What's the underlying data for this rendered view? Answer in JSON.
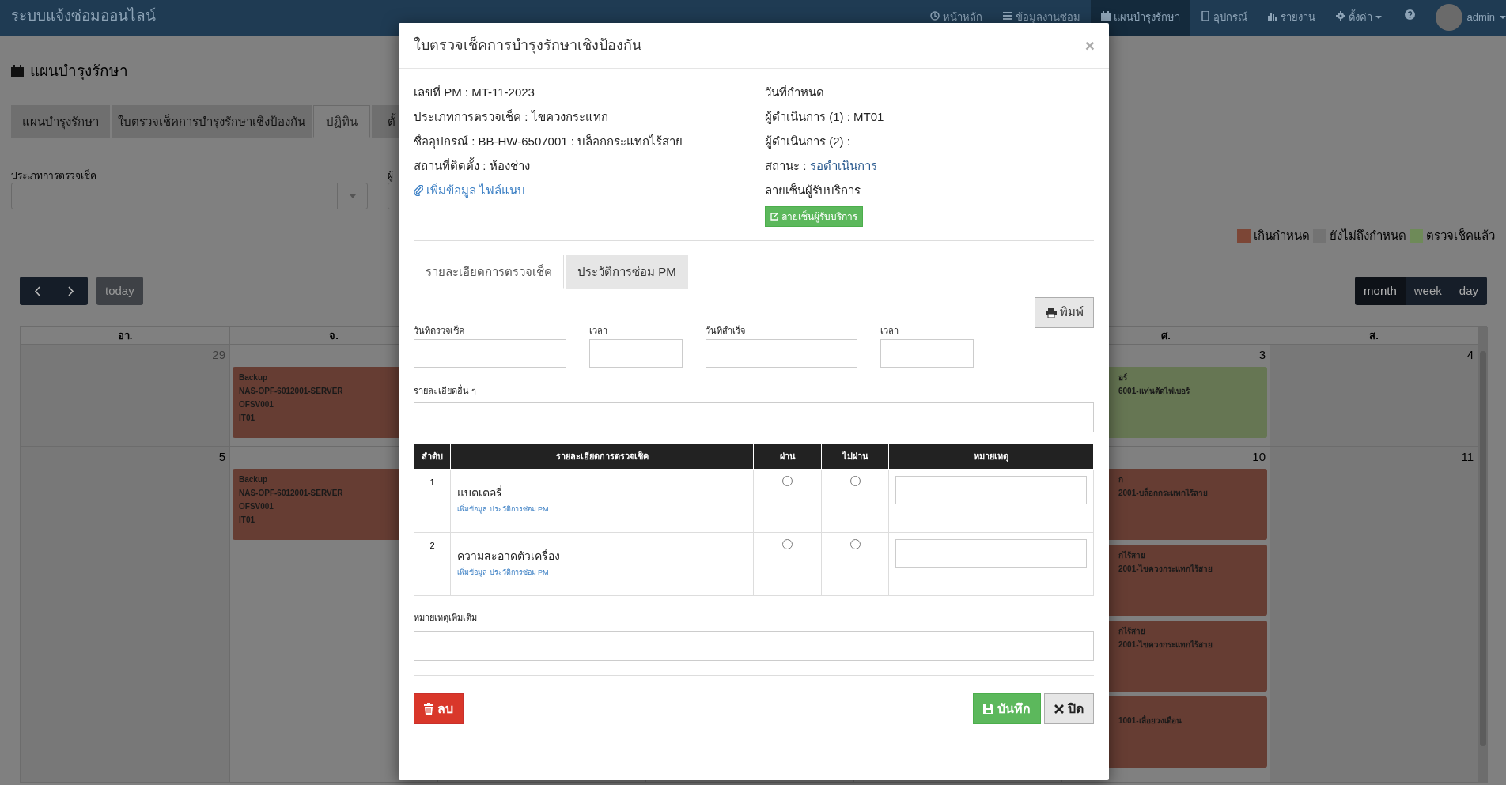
{
  "navbar": {
    "brand": "ระบบแจ้งซ่อมออนไลน์",
    "items": [
      {
        "label": "หน้าหลัก",
        "selected": false,
        "dropdown": false
      },
      {
        "label": "ข้อมูลงานซ่อม",
        "selected": false,
        "dropdown": false
      },
      {
        "label": "แผนบำรุงรักษา",
        "selected": true,
        "dropdown": false
      },
      {
        "label": "อุปกรณ์",
        "selected": false,
        "dropdown": false
      },
      {
        "label": "รายงาน",
        "selected": false,
        "dropdown": false
      },
      {
        "label": "ตั้งค่า",
        "selected": false,
        "dropdown": true
      }
    ],
    "user": "admin"
  },
  "page": {
    "title": "แผนบำรุงรักษา",
    "tabs": [
      {
        "label": "แผนบำรุงรักษา",
        "selected": false
      },
      {
        "label": "ใบตรวจเช็คการบำรุงรักษาเชิงป้องกัน",
        "selected": false
      },
      {
        "label": "ปฏิทิน",
        "selected": true
      },
      {
        "label": "ตั้",
        "selected": false
      }
    ],
    "filters": [
      {
        "label": "ประเภทการตรวจเช็ค",
        "kind": "select"
      },
      {
        "label": "ผู้",
        "kind": "input"
      }
    ]
  },
  "legend": [
    {
      "label": "เกินกำหนด",
      "color": "#7c4636"
    },
    {
      "label": "ยังไม่ถึงกำหนด",
      "color": "#737373"
    },
    {
      "label": "ตรวจเช็คแล้ว",
      "color": "#6e8a58"
    }
  ],
  "calendar": {
    "today": "today",
    "views": [
      {
        "label": "month",
        "selected": true
      },
      {
        "label": "week",
        "selected": false
      },
      {
        "label": "day",
        "selected": false
      }
    ],
    "left_days": [
      "อา.",
      "จ."
    ],
    "right_days": [
      "ศ.",
      "ส."
    ],
    "weeks": [
      {
        "days": [
          {
            "date": "29",
            "other_month": true
          },
          {
            "events": [
              {
                "lines": [
                  "Backup",
                  "NAS-OPF-6012001-SERVER",
                  "OFSV001",
                  "IT01"
                ],
                "color": "#663d33"
              }
            ]
          },
          {
            "date": "3",
            "other_month": false,
            "events": [
              {
                "lines": [
                  "อร์",
                  "6001-แท่นตัดไฟเบอร์"
                ],
                "color": "#667653"
              }
            ]
          },
          {
            "date": "4",
            "other_month": false
          }
        ]
      },
      {
        "days": [
          {
            "date": "5",
            "other_month": false
          },
          {
            "events": [
              {
                "lines": [
                  "Backup",
                  "NAS-OPF-6012001-SERVER",
                  "OFSV001",
                  "IT01"
                ],
                "color": "#663d33"
              }
            ]
          },
          {
            "date": "10",
            "other_month": false,
            "events": [
              {
                "lines": [
                  "ก",
                  "2001-บล็อกกระแทกไร้สาย"
                ],
                "color": "#663d33"
              },
              {
                "lines": [
                  "กไร้สาย",
                  "2001-ไขควงกระแทกไร้สาย"
                ],
                "color": "#663d33"
              },
              {
                "lines": [
                  "กไร้สาย",
                  "2001-ไขควงกระแทกไร้สาย"
                ],
                "color": "#663d33"
              },
              {
                "lines": [
                  "1001-เลื่อยวงเดือน"
                ],
                "color": "#663d33"
              }
            ]
          },
          {
            "date": "11",
            "other_month": false
          }
        ]
      }
    ]
  },
  "modal": {
    "title": "ใบตรวจเช็คการบำรุงรักษาเชิงป้องกัน",
    "close": "×",
    "left_info": [
      "เลขที่ PM : MT-11-2023",
      "ประเภทการตรวจเช็ค : ไขควงกระแทก",
      "ชื่ออุปกรณ์ : BB-HW-6507001 : บล็อกกระแทกไร้สาย",
      "สถานที่ติดตั้ง : ห้องช่าง"
    ],
    "attach_link": "เพิ่มข้อมูล ไฟล์แนบ",
    "right_info": [
      {
        "label": "วันที่กำหนด"
      },
      {
        "label": "ผู้ดำเนินการ (1) : MT01"
      },
      {
        "label": "ผู้ดำเนินการ (2) :"
      },
      {
        "label": "สถานะ :",
        "status": "รอดำเนินการ"
      },
      {
        "label": "ลายเซ็นผู้รับบริการ"
      }
    ],
    "sign_button": "ลายเซ็นผู้รับบริการ",
    "tabs": [
      {
        "label": "รายละเอียดการตรวจเช็ค",
        "selected": true
      },
      {
        "label": "ประวัติการซ่อม PM",
        "selected": false
      }
    ],
    "print_button": "พิมพ์",
    "date_fields": [
      {
        "label": "วันที่ตรวจเช็ค"
      },
      {
        "label": "เวลา"
      },
      {
        "label": "วันที่สำเร็จ"
      },
      {
        "label": "เวลา"
      }
    ],
    "details_label": "รายละเอียดอื่น ๆ",
    "table": {
      "columns": [
        "ลำดับ",
        "รายละเอียดการตรวจเช็ค",
        "ผ่าน",
        "ไม่ผ่าน",
        "หมายเหตุ"
      ],
      "rows": [
        {
          "no": "1",
          "item": "แบตเตอรี่",
          "link": "เพิ่มข้อมูล ประวัติการซ่อม PM",
          "pass": false,
          "fail": false
        },
        {
          "no": "2",
          "item": "ความสะอาดตัวเครื่อง",
          "link": "เพิ่มข้อมูล ประวัติการซ่อม PM",
          "pass": false,
          "fail": false
        }
      ]
    },
    "remarks_label": "หมายเหตุเพิ่มเติม",
    "buttons": [
      {
        "label": "ลบ",
        "kind": "delete"
      },
      {
        "label": "บันทึก",
        "kind": "save"
      },
      {
        "label": "ปิด",
        "kind": "close"
      }
    ]
  }
}
